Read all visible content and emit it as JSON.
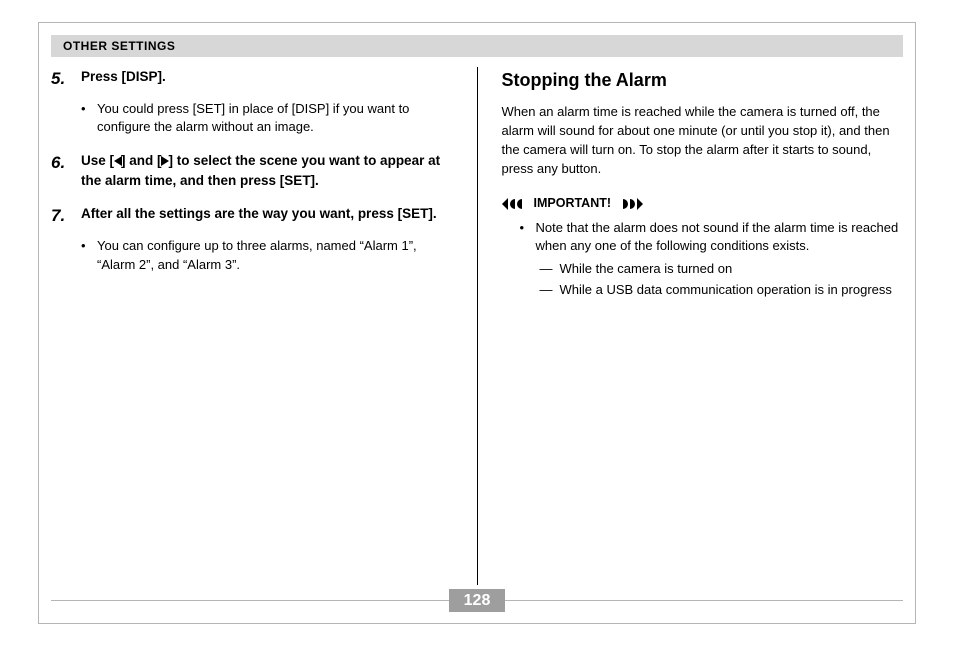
{
  "header": {
    "title": "OTHER SETTINGS"
  },
  "left": {
    "step5": {
      "num": "5.",
      "text": "Press [DISP]."
    },
    "step5_bullet": "You could press [SET] in place of [DISP] if you want to configure the alarm without an image.",
    "step6": {
      "num": "6.",
      "text_pre": "Use [",
      "text_mid": "] and [",
      "text_post": "] to select the scene you want to appear at the alarm time, and then press [SET]."
    },
    "step7": {
      "num": "7.",
      "text": "After all the settings are the way you want, press [SET]."
    },
    "step7_bullet": "You can configure up to three alarms, named “Alarm 1”, “Alarm 2”, and “Alarm 3”."
  },
  "right": {
    "heading": "Stopping the Alarm",
    "para": "When an alarm time is reached while the camera is turned off, the alarm will sound for about one minute (or until you stop it), and then the camera will turn on. To stop the alarm after it starts to sound, press any button.",
    "important_label": "IMPORTANT!",
    "imp_bullet": "Note that the alarm does not sound if the alarm time is reached when any one of the following conditions exists.",
    "dash1": "While the camera is turned on",
    "dash2": "While a USB data communication operation is in progress"
  },
  "footer": {
    "page": "128"
  }
}
